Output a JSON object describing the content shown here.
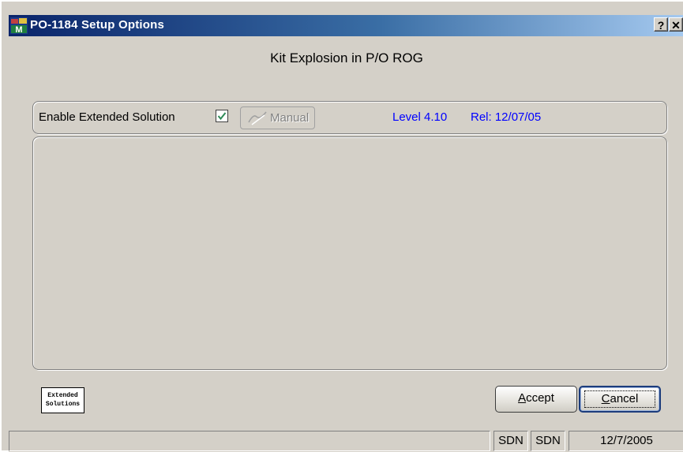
{
  "window": {
    "title": "PO-1184 Setup Options",
    "help_label": "?",
    "close_label": "✕"
  },
  "main": {
    "heading": "Kit Explosion in P/O ROG",
    "enable_label": "Enable Extended Solution",
    "enable_checked": true,
    "manual_label": "Manual",
    "level": "Level 4.10",
    "release": "Rel: 12/07/05"
  },
  "logo": {
    "line1": "Extended",
    "line2": "Solutions"
  },
  "buttons": {
    "accept_first": "A",
    "accept_rest": "ccept",
    "cancel_first": "C",
    "cancel_rest": "ancel"
  },
  "statusbar": {
    "message": "",
    "user": "SDN",
    "company": "SDN",
    "date": "12/7/2005"
  },
  "colors": {
    "title_start": "#0a246a",
    "title_end": "#a6caf0",
    "info_text": "#0000ff",
    "face": "#d4d0c8"
  },
  "icons": [
    "app-icon",
    "help-icon",
    "close-icon",
    "check-icon",
    "pen-icon"
  ]
}
